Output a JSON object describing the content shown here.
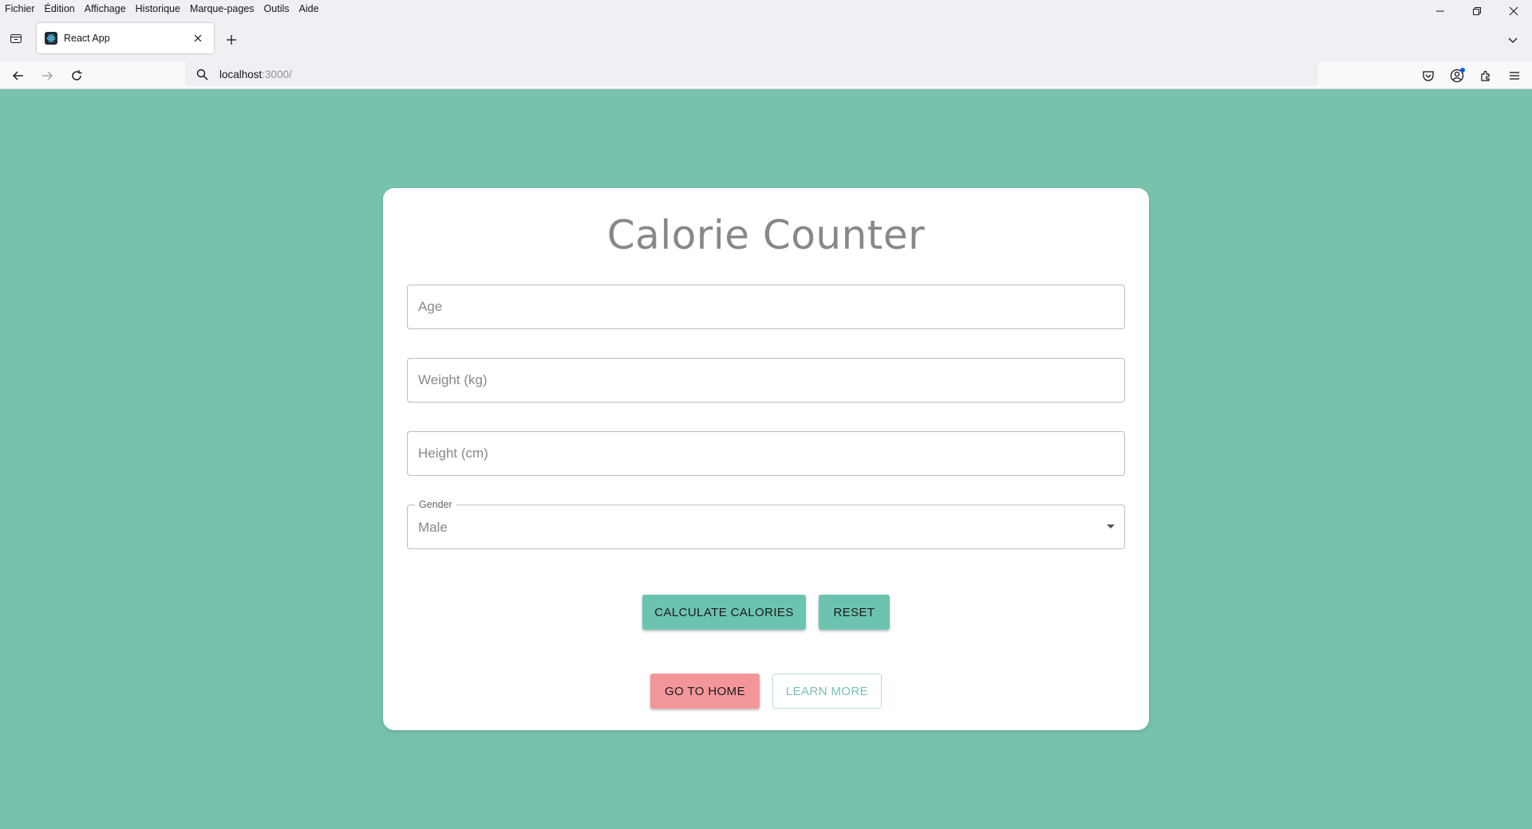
{
  "browser": {
    "menu": [
      "Fichier",
      "Édition",
      "Affichage",
      "Historique",
      "Marque-pages",
      "Outils",
      "Aide"
    ],
    "tab_title": "React App",
    "url_host": "localhost",
    "url_rest": ":3000/"
  },
  "page": {
    "title": "Calorie Counter",
    "fields": {
      "age_placeholder": "Age",
      "weight_placeholder": "Weight (kg)",
      "height_placeholder": "Height (cm)"
    },
    "gender": {
      "label": "Gender",
      "value": "Male"
    },
    "buttons": {
      "calculate": "CALCULATE CALORIES",
      "reset": "RESET",
      "home": "GO TO HOME",
      "learn_more": "LEARN MORE"
    }
  },
  "colors": {
    "background": "#78c2ad",
    "primary": "#6cc3b0",
    "danger": "#f3969a"
  }
}
